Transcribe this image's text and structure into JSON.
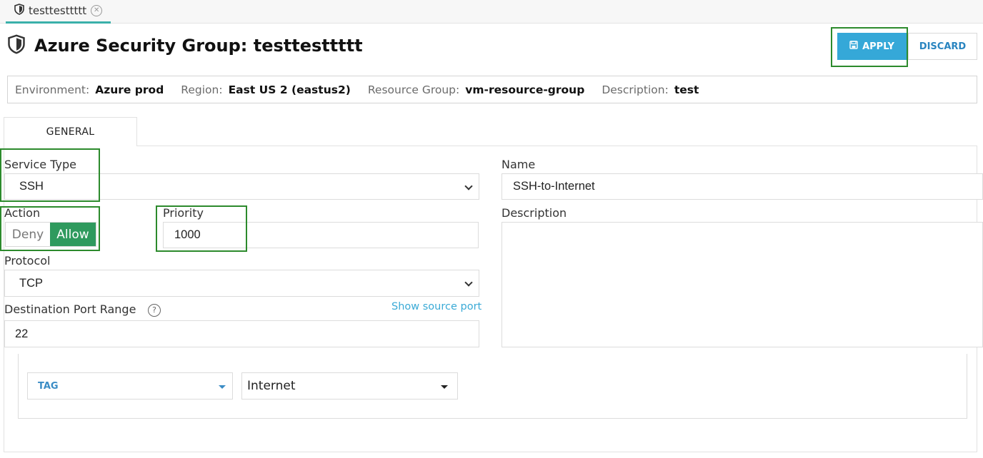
{
  "tab": {
    "label": "testtesttttt",
    "icon": "shield-icon",
    "close_icon": "close-icon"
  },
  "header": {
    "title": "Azure Security Group: testtesttttt",
    "icon": "shield-icon"
  },
  "toolbar": {
    "apply_label": "APPLY",
    "apply_icon": "save-icon",
    "discard_label": "DISCARD"
  },
  "info": {
    "environment_label": "Environment:",
    "environment_value": "Azure prod",
    "region_label": "Region:",
    "region_value": "East US 2 (eastus2)",
    "resource_group_label": "Resource Group:",
    "resource_group_value": "vm-resource-group",
    "description_label": "Description:",
    "description_value": "test"
  },
  "tabs": [
    {
      "label": "GENERAL",
      "active": true
    }
  ],
  "form": {
    "service_type_label": "Service Type",
    "service_type_value": "SSH",
    "name_label": "Name",
    "name_value": "SSH-to-Internet",
    "action_label": "Action",
    "action_deny": "Deny",
    "action_allow": "Allow",
    "action_selected": "Allow",
    "priority_label": "Priority",
    "priority_value": "1000",
    "description_label": "Description",
    "description_value": "",
    "protocol_label": "Protocol",
    "protocol_value": "TCP",
    "dest_port_label": "Destination Port Range",
    "dest_port_value": "22",
    "show_source_port": "Show source port",
    "tag_value": "TAG",
    "tag_target_value": "Internet"
  },
  "colors": {
    "accent": "#35a8d8",
    "allow": "#2f9a5e",
    "highlight": "#2c8a2c",
    "link": "#3aaad6"
  }
}
